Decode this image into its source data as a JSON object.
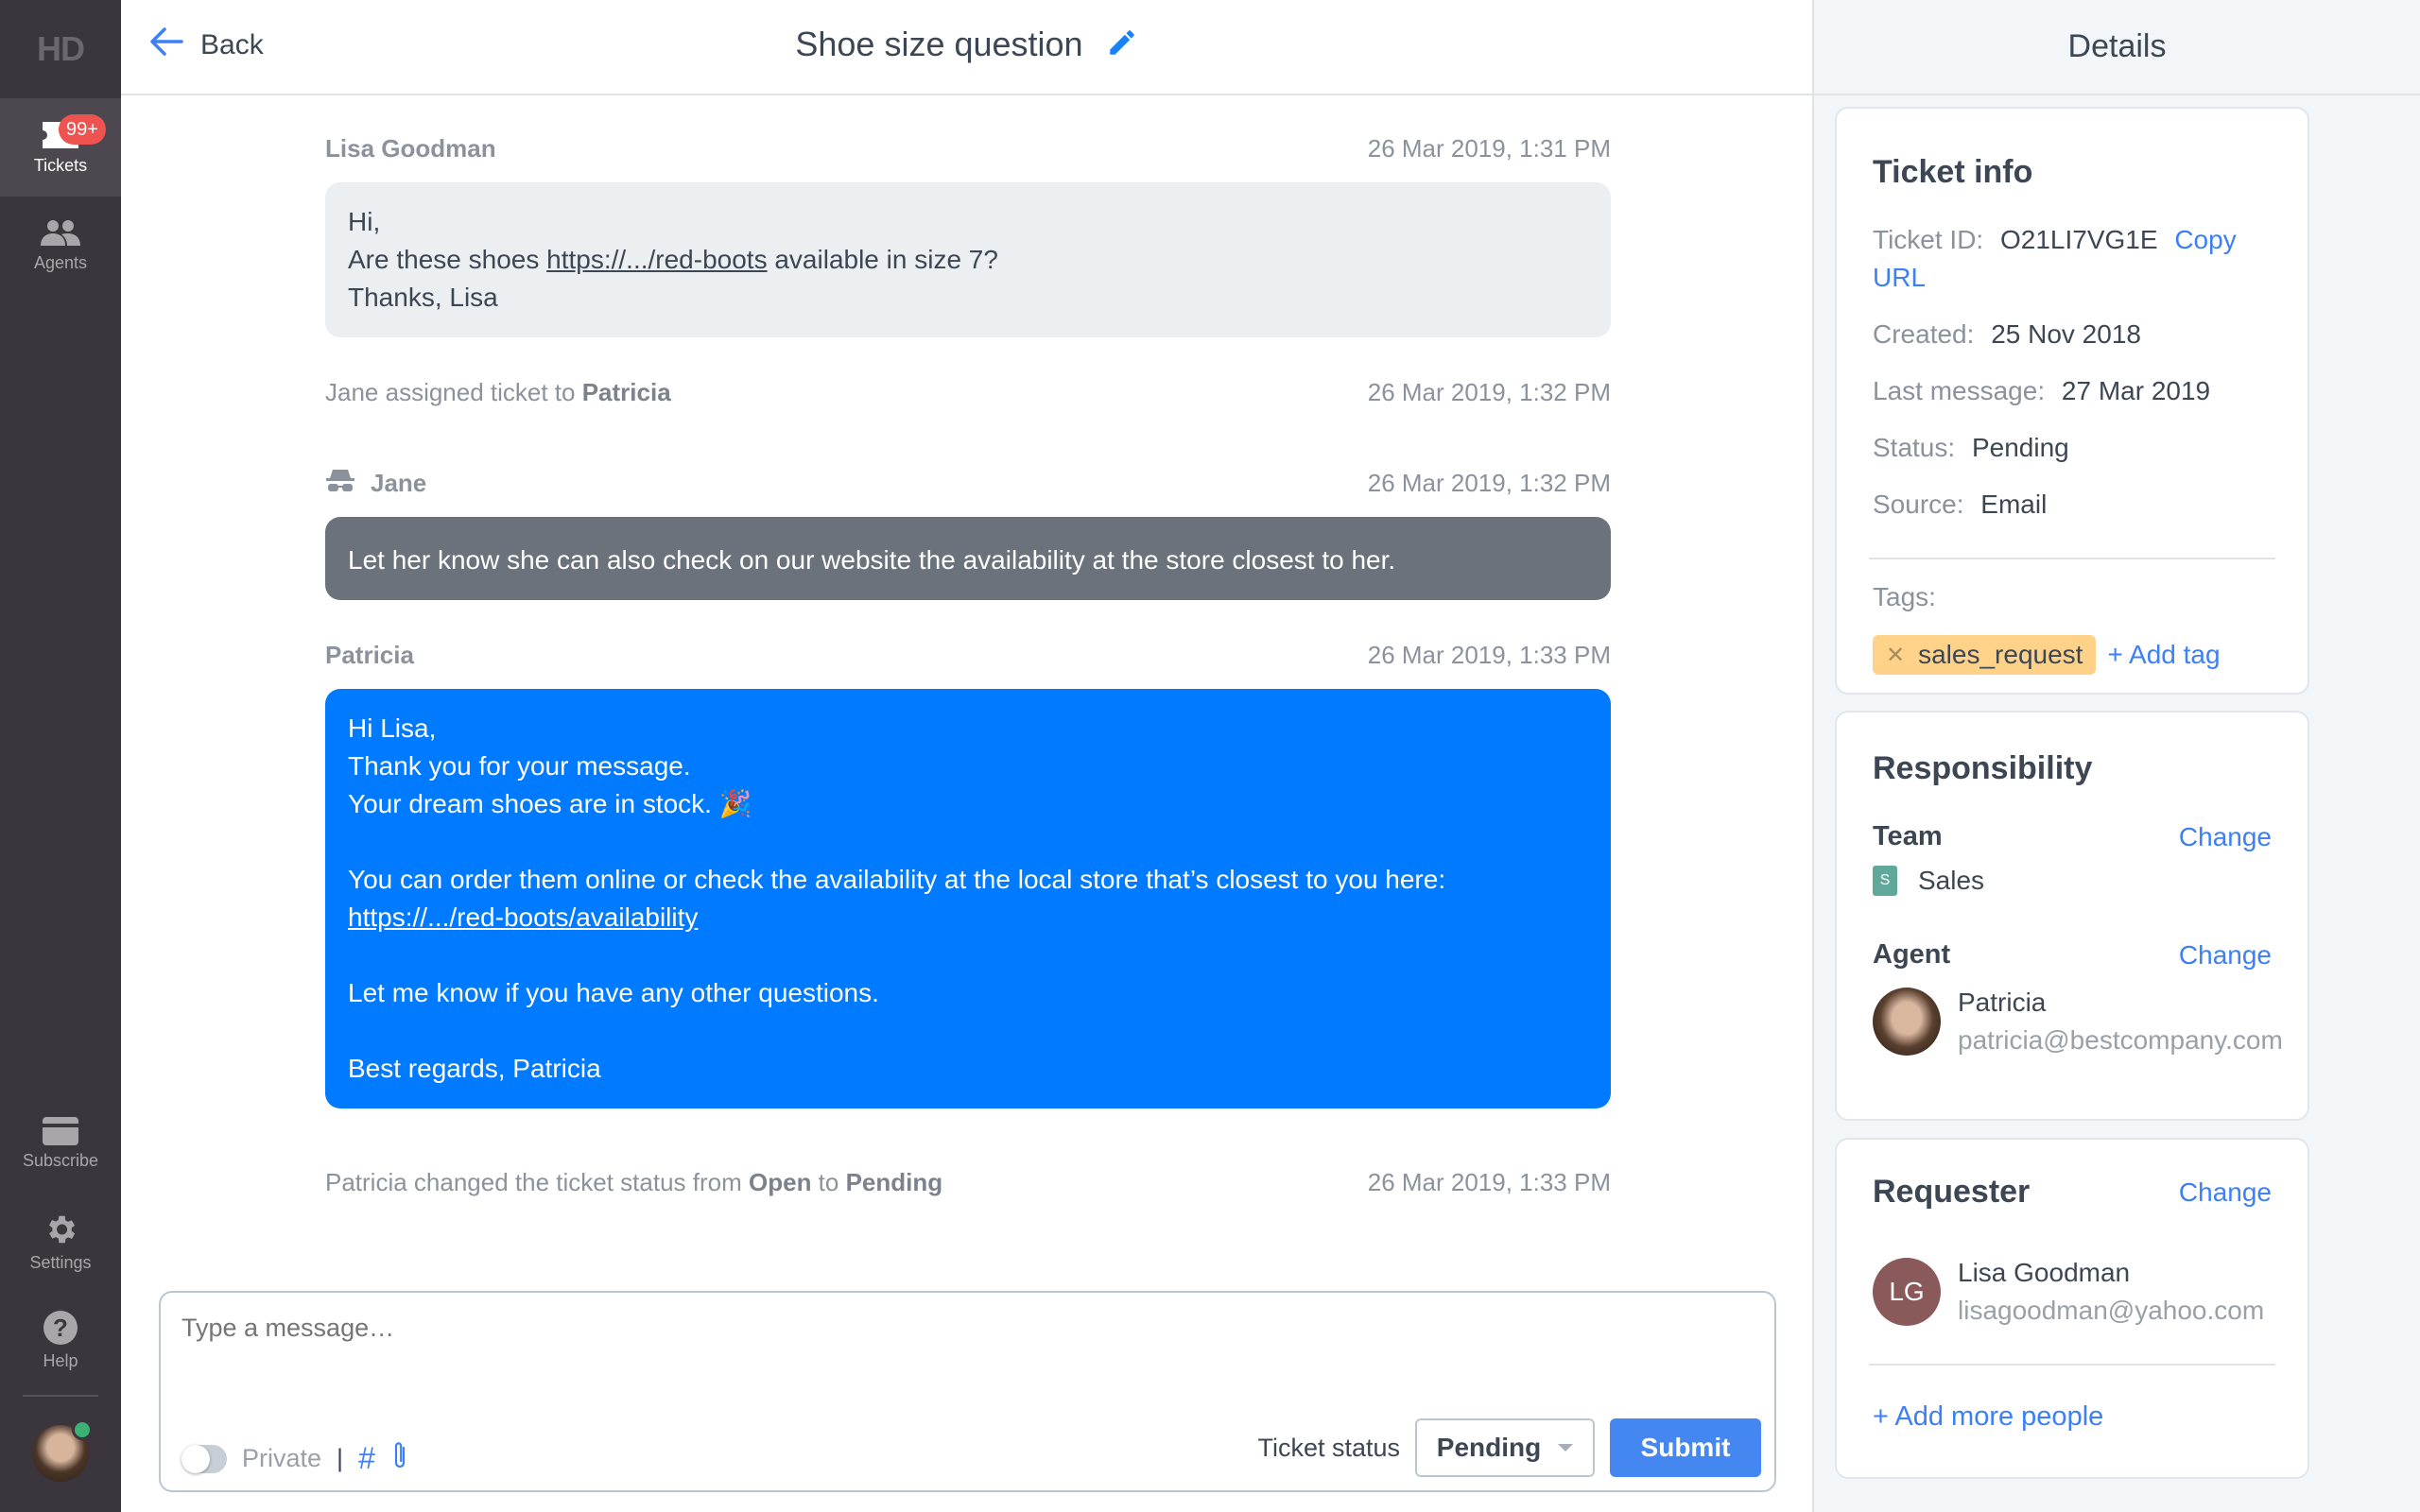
{
  "nav": {
    "logo": "HD",
    "items": [
      {
        "label": "Tickets",
        "icon": "ticket-icon",
        "badge": "99+",
        "active": true
      },
      {
        "label": "Agents",
        "icon": "agents-icon"
      }
    ],
    "bottom_items": [
      {
        "label": "Subscribe",
        "icon": "credit-card-icon"
      },
      {
        "label": "Settings",
        "icon": "gear-icon"
      },
      {
        "label": "Help",
        "icon": "help-icon"
      }
    ],
    "user_status": "online"
  },
  "header": {
    "back_label": "Back",
    "title": "Shoe size question"
  },
  "conversation": {
    "message1": {
      "author": "Lisa Goodman",
      "time": "26 Mar 2019, 1:31 PM",
      "line1": "Hi,",
      "line2_pre": "Are these shoes ",
      "line2_link": "https://.../red-boots",
      "line2_post": " available in size 7?",
      "line3": "Thanks, Lisa"
    },
    "event1": {
      "text": "Jane assigned ticket to ",
      "bold": "Patricia",
      "time": "26 Mar 2019, 1:32 PM"
    },
    "note": {
      "author": "Jane",
      "time": "26 Mar 2019, 1:32 PM",
      "text": "Let her know she can also check on our website the availability at the store closest to her."
    },
    "message2": {
      "author": "Patricia",
      "time": "26 Mar 2019, 1:33 PM",
      "line1": "Hi Lisa,",
      "line2": "Thank you for your message.",
      "line3": "Your dream shoes are in stock. 🎉",
      "line4": "You can order them online or check the availability at the local store that’s closest to you here:",
      "link": "https://.../red-boots/availability",
      "line5": "Let me know if you have any other questions.",
      "line6": "Best regards, Patricia"
    },
    "event2": {
      "pre": "Patricia changed the ticket status from ",
      "from": "Open",
      "mid": " to ",
      "to": "Pending",
      "time": "26 Mar 2019, 1:33 PM"
    }
  },
  "composer": {
    "placeholder": "Type a message…",
    "private_label": "Private",
    "private_on": false,
    "separator": "|",
    "hashtag": "#",
    "status_label": "Ticket status",
    "status_value": "Pending",
    "submit_label": "Submit"
  },
  "details": {
    "title": "Details",
    "ticket_info": {
      "heading": "Ticket info",
      "id_label": "Ticket ID:",
      "id_value": "O21LI7VG1E",
      "copy_url": "Copy URL",
      "created_label": "Created:",
      "created_value": "25 Nov 2018",
      "last_label": "Last message:",
      "last_value": "27 Mar 2019",
      "status_label": "Status:",
      "status_value": "Pending",
      "source_label": "Source:",
      "source_value": "Email",
      "tags_label": "Tags:",
      "tags": [
        "sales_request"
      ],
      "add_tag": "+ Add tag"
    },
    "responsibility": {
      "heading": "Responsibility",
      "team_label": "Team",
      "team_change": "Change",
      "team_initial": "S",
      "team_name": "Sales",
      "agent_label": "Agent",
      "agent_change": "Change",
      "agent_name": "Patricia",
      "agent_email": "patricia@bestcompany.com"
    },
    "requester": {
      "heading": "Requester",
      "change": "Change",
      "initials": "LG",
      "name": "Lisa Goodman",
      "email": "lisagoodman@yahoo.com",
      "add_more": "+ Add more people"
    }
  },
  "colors": {
    "nav_bg": "#3b363d",
    "accent_blue": "#007aff",
    "link_blue": "#3d7ff5",
    "badge_red": "#ef5350",
    "note_gray": "#6b727b",
    "tag_yellow": "#ffd28a",
    "online_green": "#3bb273"
  }
}
